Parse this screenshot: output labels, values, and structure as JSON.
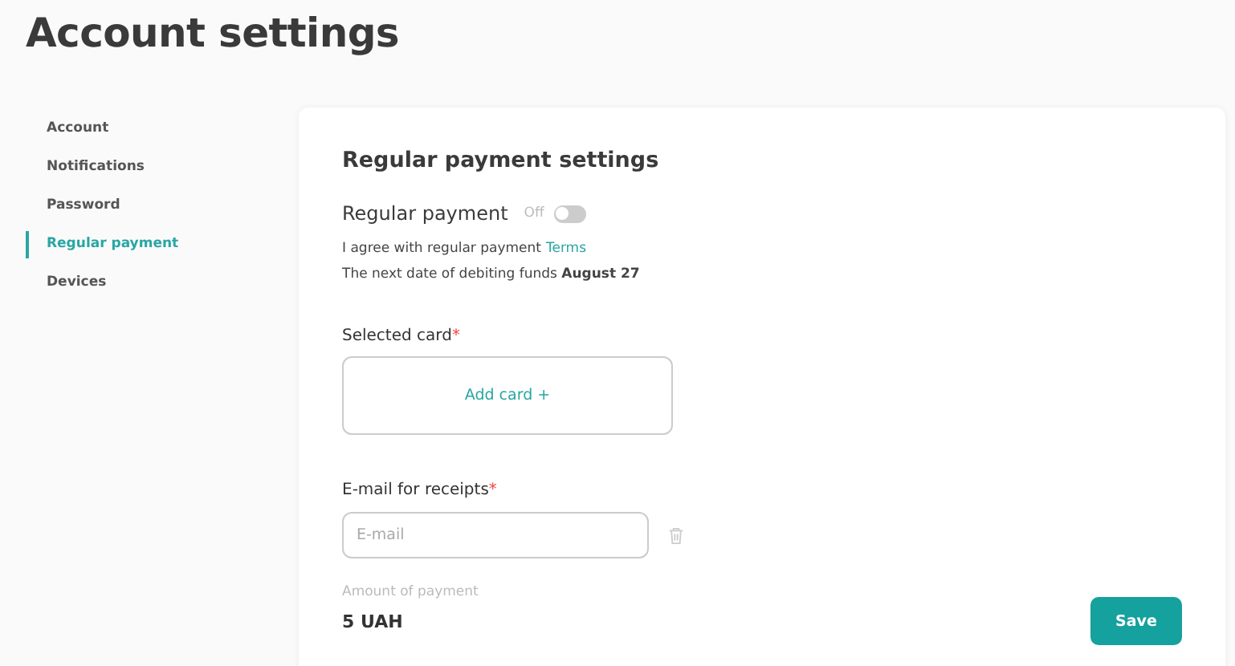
{
  "page_title": "Account settings",
  "sidebar": {
    "items": [
      {
        "label": "Account",
        "selected": false
      },
      {
        "label": "Notifications",
        "selected": false
      },
      {
        "label": "Password",
        "selected": false
      },
      {
        "label": "Regular payment",
        "selected": true
      },
      {
        "label": "Devices",
        "selected": false
      }
    ]
  },
  "panel": {
    "heading": "Regular payment settings",
    "regular_payment": {
      "label": "Regular payment",
      "state_text": "Off",
      "on": false
    },
    "agreement": {
      "text": "I agree with regular payment",
      "link": "Terms"
    },
    "next_date": "The next date of debiting funds **August 27**",
    "selected_card": {
      "label": "Selected card",
      "required_mark": "*",
      "add_card": "Add card +"
    },
    "email": {
      "label": "E-mail for receipts",
      "required_mark": "*",
      "placeholder": "E-mail"
    },
    "amount": {
      "label": "Amount of payment",
      "value": "5 UAH"
    },
    "save_button": "Save"
  }
}
